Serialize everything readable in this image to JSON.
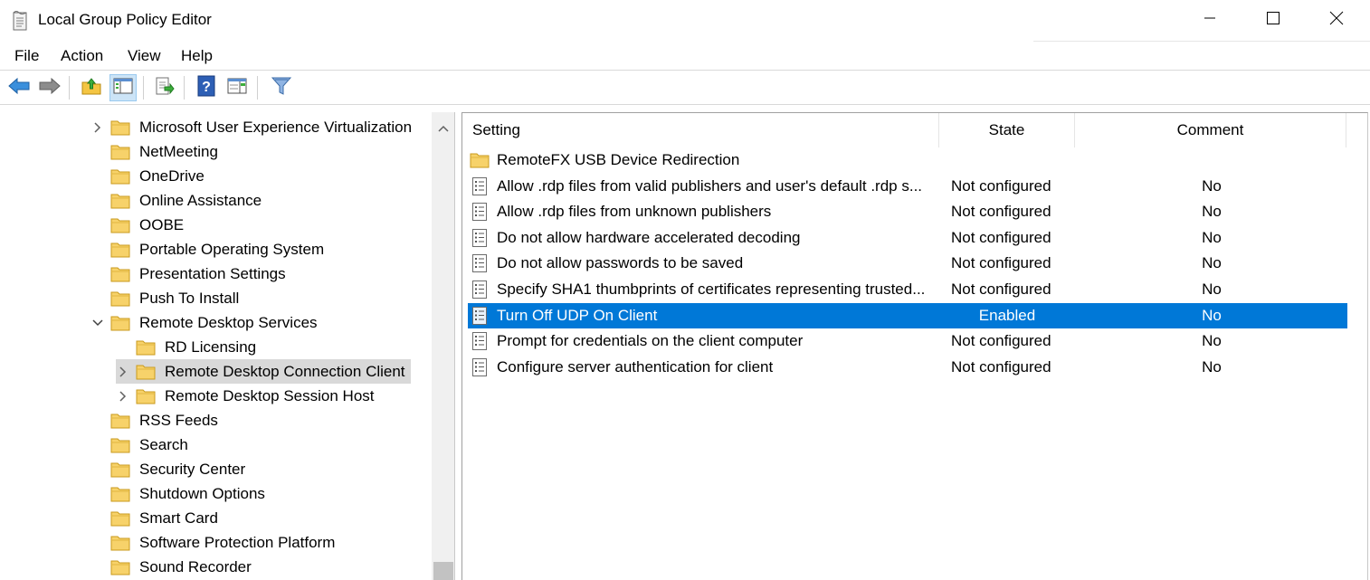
{
  "window": {
    "title": "Local Group Policy Editor",
    "app_icon": "policy-document-icon"
  },
  "menu": {
    "items": [
      {
        "label": "File"
      },
      {
        "label": "Action"
      },
      {
        "label": "View"
      },
      {
        "label": "Help"
      }
    ]
  },
  "toolbar": {
    "buttons": [
      "back-arrow-icon",
      "forward-arrow-icon",
      "up-folder-icon",
      "show-hide-console-tree-icon",
      "export-list-icon",
      "help-icon",
      "extended-view-icon",
      "filter-icon"
    ]
  },
  "tree": {
    "items": [
      {
        "label": "Microsoft User Experience Virtualization",
        "expander": "collapsed"
      },
      {
        "label": "NetMeeting",
        "expander": "none"
      },
      {
        "label": "OneDrive",
        "expander": "none"
      },
      {
        "label": "Online Assistance",
        "expander": "none"
      },
      {
        "label": "OOBE",
        "expander": "none"
      },
      {
        "label": "Portable Operating System",
        "expander": "none"
      },
      {
        "label": "Presentation Settings",
        "expander": "none"
      },
      {
        "label": "Push To Install",
        "expander": "none"
      },
      {
        "label": "Remote Desktop Services",
        "expander": "expanded"
      },
      {
        "label": "RD Licensing",
        "expander": "none"
      },
      {
        "label": "Remote Desktop Connection Client",
        "expander": "collapsed",
        "selected": true
      },
      {
        "label": "Remote Desktop Session Host",
        "expander": "collapsed"
      },
      {
        "label": "RSS Feeds",
        "expander": "none"
      },
      {
        "label": "Search",
        "expander": "none"
      },
      {
        "label": "Security Center",
        "expander": "none"
      },
      {
        "label": "Shutdown Options",
        "expander": "none"
      },
      {
        "label": "Smart Card",
        "expander": "none"
      },
      {
        "label": "Software Protection Platform",
        "expander": "none"
      },
      {
        "label": "Sound Recorder",
        "expander": "none"
      }
    ]
  },
  "list": {
    "columns": {
      "setting": "Setting",
      "state": "State",
      "comment": "Comment"
    },
    "rows": [
      {
        "type": "folder",
        "setting": "RemoteFX USB Device Redirection",
        "state": "",
        "comment": ""
      },
      {
        "type": "policy",
        "setting": "Allow .rdp files from valid publishers and user's default .rdp s...",
        "state": "Not configured",
        "comment": "No"
      },
      {
        "type": "policy",
        "setting": "Allow .rdp files from unknown publishers",
        "state": "Not configured",
        "comment": "No"
      },
      {
        "type": "policy",
        "setting": "Do not allow hardware accelerated decoding",
        "state": "Not configured",
        "comment": "No"
      },
      {
        "type": "policy",
        "setting": "Do not allow passwords to be saved",
        "state": "Not configured",
        "comment": "No"
      },
      {
        "type": "policy",
        "setting": "Specify SHA1 thumbprints of certificates representing trusted...",
        "state": "Not configured",
        "comment": "No"
      },
      {
        "type": "policy",
        "setting": "Turn Off UDP On Client",
        "state": "Enabled",
        "comment": "No",
        "selected": true
      },
      {
        "type": "policy",
        "setting": "Prompt for credentials on the client computer",
        "state": "Not configured",
        "comment": "No"
      },
      {
        "type": "policy",
        "setting": "Configure server authentication for client",
        "state": "Not configured",
        "comment": "No"
      }
    ]
  },
  "colors": {
    "selection": "#0078d7",
    "tree_selection": "#d9d9d9",
    "folder": "#f4c542"
  }
}
